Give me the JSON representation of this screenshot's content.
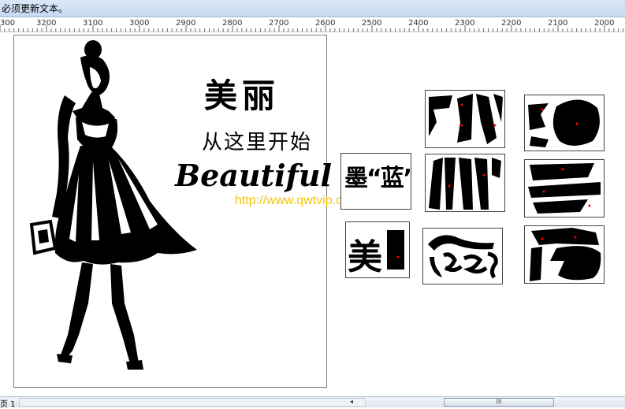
{
  "topbar": {
    "text": "必须更新文本。"
  },
  "ruler": {
    "labels": [
      "300",
      "3200",
      "3100",
      "3000",
      "2900",
      "2800",
      "2700",
      "2600",
      "2500",
      "2400",
      "2300",
      "2200",
      "2100",
      "2000"
    ]
  },
  "artwork": {
    "headline": "美丽",
    "subline": "从这里开始",
    "script_text": "Beautiful",
    "watermark": "http://www.qwtvip.cn"
  },
  "pieces": {
    "text_piece": "墨“蓝”",
    "mei_piece": "美"
  },
  "statusbar": {
    "page_tab": "页 1",
    "scroll_thumb": "III"
  },
  "colors": {
    "watermark": "#f2c400",
    "marker": "#ff0000",
    "title_bar": "#c6d9f2"
  }
}
